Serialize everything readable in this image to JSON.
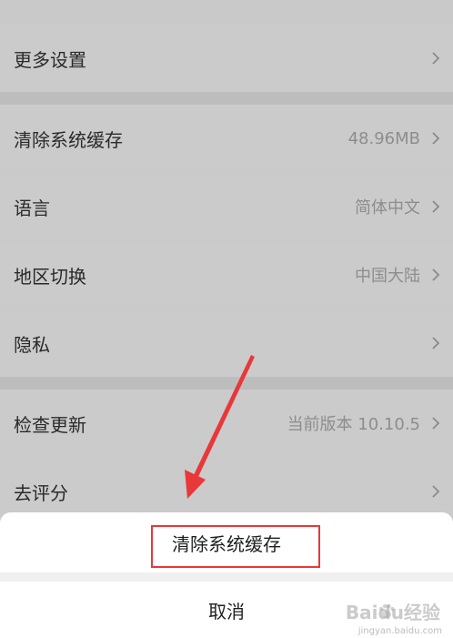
{
  "settings": {
    "rows": [
      {
        "label": "更多设置",
        "value": ""
      },
      {
        "label": "清除系统缓存",
        "value": "48.96MB"
      },
      {
        "label": "语言",
        "value": "简体中文"
      },
      {
        "label": "地区切换",
        "value": "中国大陆"
      },
      {
        "label": "隐私",
        "value": ""
      },
      {
        "label": "检查更新",
        "value": "当前版本 10.10.5"
      },
      {
        "label": "去评分",
        "value": ""
      }
    ]
  },
  "sheet": {
    "action_label": "清除系统缓存",
    "cancel_label": "取消"
  },
  "watermark": {
    "main": "Baidu经验",
    "sub": "jingyan.baidu.com"
  },
  "colors": {
    "annotation_red": "#e8383a"
  }
}
